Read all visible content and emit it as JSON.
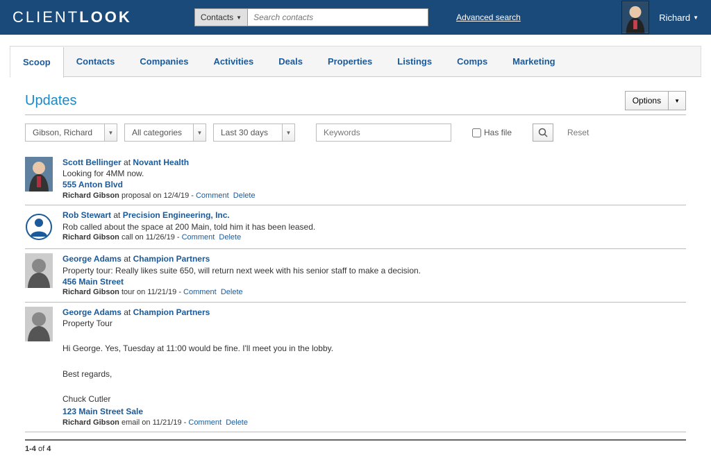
{
  "header": {
    "logo_thin": "CLIENT",
    "logo_bold": "LOOK",
    "search_scope": "Contacts",
    "search_placeholder": "Search contacts",
    "advanced_search": "Advanced search",
    "username": "Richard"
  },
  "tabs": [
    {
      "label": "Scoop",
      "active": true
    },
    {
      "label": "Contacts"
    },
    {
      "label": "Companies"
    },
    {
      "label": "Activities"
    },
    {
      "label": "Deals"
    },
    {
      "label": "Properties"
    },
    {
      "label": "Listings"
    },
    {
      "label": "Comps"
    },
    {
      "label": "Marketing"
    }
  ],
  "page": {
    "title": "Updates",
    "options_label": "Options"
  },
  "filters": {
    "user": "Gibson, Richard",
    "category": "All categories",
    "range": "Last 30 days",
    "keywords_placeholder": "Keywords",
    "has_file_label": "Has file",
    "reset_label": "Reset"
  },
  "feed": [
    {
      "contact": "Scott Bellinger",
      "at": " at ",
      "company": "Novant Health",
      "desc": "Looking for 4MM now.",
      "loc": "555 Anton Blvd",
      "author": "Richard Gibson",
      "meta_text": " proposal on 12/4/19 - ",
      "comment": "Comment",
      "delete": "Delete",
      "thumb": "man-photo",
      "body_lines": []
    },
    {
      "contact": "Rob Stewart",
      "at": " at ",
      "company": "Precision Engineering, Inc.",
      "desc": "Rob called about the space at 200 Main, told him it has been leased.",
      "loc": "",
      "author": "Richard Gibson",
      "meta_text": " call on 11/26/19 - ",
      "comment": "Comment",
      "delete": "Delete",
      "thumb": "placeholder",
      "body_lines": []
    },
    {
      "contact": "George Adams",
      "at": " at ",
      "company": "Champion Partners",
      "desc": "Property tour: Really likes suite 650, will return next week with his senior staff to make a decision.",
      "loc": "456 Main Street",
      "author": "Richard Gibson",
      "meta_text": " tour on 11/21/19 - ",
      "comment": "Comment",
      "delete": "Delete",
      "thumb": "bw-photo",
      "body_lines": []
    },
    {
      "contact": "George Adams",
      "at": " at ",
      "company": "Champion Partners",
      "desc": "Property Tour",
      "loc": "123 Main Street Sale",
      "author": "Richard Gibson",
      "meta_text": " email on 11/21/19 - ",
      "comment": "Comment",
      "delete": "Delete",
      "thumb": "bw-photo",
      "body_lines": [
        "",
        "Hi George. Yes, Tuesday at 11:00 would be fine. I'll meet you in the lobby.",
        "",
        "Best regards,",
        "",
        "Chuck Cutler"
      ]
    }
  ],
  "pager": {
    "range": "1-4",
    "of": " of ",
    "total": "4"
  }
}
